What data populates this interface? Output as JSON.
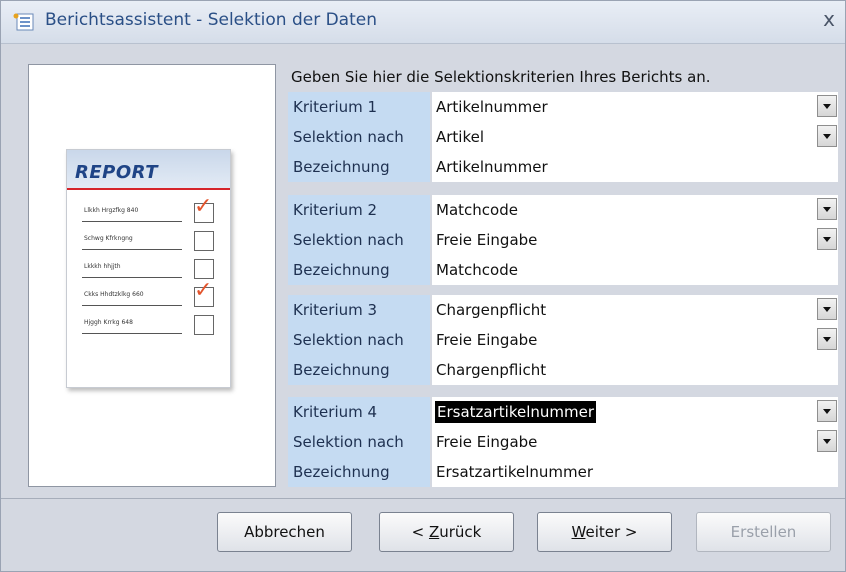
{
  "window": {
    "title": "Berichtsassistent - Selektion der Daten",
    "close_label": "x"
  },
  "preview": {
    "report_title": "REPORT",
    "rows": [
      {
        "text": "Llkkh Hrgzfkg 840",
        "checked": true
      },
      {
        "text": "Schwg Kfrkngng",
        "checked": false
      },
      {
        "text": "Lkkkh hhjjth",
        "checked": false
      },
      {
        "text": "Ckks Hhdtzklkg 660",
        "checked": true
      },
      {
        "text": "Hjggh Krrkg 648",
        "checked": false
      }
    ]
  },
  "instruction": "Geben Sie hier die Selektionskriterien Ihres Berichts an.",
  "groups": [
    {
      "crit_label": "Kriterium 1",
      "crit_value": "Artikelnummer",
      "sel_label": "Selektion nach",
      "sel_value": "Artikel",
      "desc_label": "Bezeichnung",
      "desc_value": "Artikelnummer"
    },
    {
      "crit_label": "Kriterium 2",
      "crit_value": "Matchcode",
      "sel_label": "Selektion nach",
      "sel_value": "Freie Eingabe",
      "desc_label": "Bezeichnung",
      "desc_value": "Matchcode"
    },
    {
      "crit_label": "Kriterium 3",
      "crit_value": "Chargenpflicht",
      "sel_label": "Selektion nach",
      "sel_value": "Freie Eingabe",
      "desc_label": "Bezeichnung",
      "desc_value": "Chargenpflicht"
    },
    {
      "crit_label": "Kriterium 4",
      "crit_value": "Ersatzartikelnummer",
      "sel_label": "Selektion nach",
      "sel_value": "Freie Eingabe",
      "desc_label": "Bezeichnung",
      "desc_value": "Ersatzartikelnummer"
    }
  ],
  "buttons": {
    "cancel": "Abbrechen",
    "back_prefix": "< ",
    "back_mnemonic": "Z",
    "back_rest": "urück",
    "next_mnemonic": "W",
    "next_rest": "eiter >",
    "create": "Erstellen"
  },
  "colors": {
    "label_bg": "#c5dbf2",
    "title_color": "#2a4f86",
    "check_color": "#e3542c",
    "report_accent": "#d6252b"
  }
}
